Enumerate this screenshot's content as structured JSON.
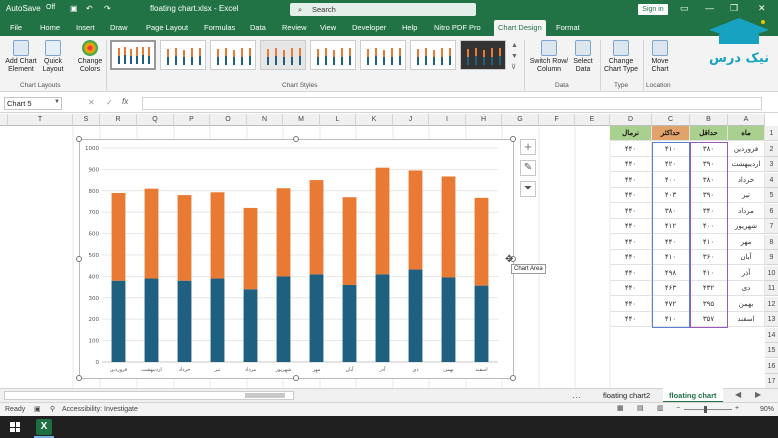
{
  "titlebar": {
    "autosave": "AutoSave",
    "autosave_state": "Off",
    "filename": "floating chart.xlsx - Excel",
    "search_placeholder": "Search",
    "signin": "Sign in"
  },
  "tabs": [
    "File",
    "Home",
    "Insert",
    "Draw",
    "Page Layout",
    "Formulas",
    "Data",
    "Review",
    "View",
    "Developer",
    "Help",
    "Nitro PDF Pro",
    "Chart Design",
    "Format"
  ],
  "active_tab": "Chart Design",
  "ribbon": {
    "add_chart_element": "Add Chart Element",
    "quick_layout": "Quick Layout",
    "change_colors": "Change Colors",
    "chart_layouts_group": "Chart Layouts",
    "chart_styles_group": "Chart Styles",
    "switch_row_col": "Switch Row/ Column",
    "select_data": "Select Data",
    "data_group": "Data",
    "change_chart_type": "Change Chart Type",
    "type_group": "Type",
    "move_chart": "Move Chart",
    "location_group": "Location"
  },
  "logo_text": "نیک درس",
  "namebox": "Chart 5",
  "columns": [
    "T",
    "S",
    "R",
    "Q",
    "P",
    "O",
    "N",
    "M",
    "L",
    "K",
    "J",
    "I",
    "H",
    "G",
    "F",
    "E",
    "D",
    "C",
    "B",
    "A"
  ],
  "table": {
    "headers": {
      "month": "ماه",
      "min": "حداقل",
      "max": "حداکثر",
      "normal": "نرمال"
    },
    "rows": [
      {
        "month": "فروردین",
        "min": "۳۸۰",
        "max": "۴۱۰",
        "normal": "۴۴۰"
      },
      {
        "month": "اردیبهشت",
        "min": "۳۹۰",
        "max": "۴۲۰",
        "normal": "۴۴۰"
      },
      {
        "month": "خرداد",
        "min": "۳۸۰",
        "max": "۴۰۰",
        "normal": "۴۴۰"
      },
      {
        "month": "تیر",
        "min": "۳۹۰",
        "max": "۴۰۳",
        "normal": "۴۴۰"
      },
      {
        "month": "مرداد",
        "min": "۳۴۰",
        "max": "۳۸۰",
        "normal": "۴۴۰"
      },
      {
        "month": "شهریور",
        "min": "۴۰۰",
        "max": "۴۱۲",
        "normal": "۴۴۰"
      },
      {
        "month": "مهر",
        "min": "۴۱۰",
        "max": "۴۴۰",
        "normal": "۴۴۰"
      },
      {
        "month": "آبان",
        "min": "۳۶۰",
        "max": "۴۱۰",
        "normal": "۴۴۰"
      },
      {
        "month": "آذر",
        "min": "۴۱۰",
        "max": "۴۹۸",
        "normal": "۴۴۰"
      },
      {
        "month": "دی",
        "min": "۴۳۲",
        "max": "۴۶۳",
        "normal": "۴۴۰"
      },
      {
        "month": "بهمن",
        "min": "۳۹۵",
        "max": "۴۷۲",
        "normal": "۴۴۰"
      },
      {
        "month": "اسفند",
        "min": "۳۵۷",
        "max": "۴۱۰",
        "normal": "۴۴۰"
      }
    ]
  },
  "chart_data": {
    "type": "bar",
    "stacked": true,
    "categories": [
      "فروردین",
      "اردیبهشت",
      "خرداد",
      "تیر",
      "مرداد",
      "شهریور",
      "مهر",
      "آبان",
      "آذر",
      "دی",
      "بهمن",
      "اسفند"
    ],
    "series": [
      {
        "values": [
          380,
          390,
          380,
          390,
          340,
          400,
          410,
          360,
          410,
          432,
          395,
          357
        ],
        "color": "#1f5f80"
      },
      {
        "values": [
          410,
          420,
          400,
          403,
          380,
          412,
          440,
          410,
          498,
          463,
          472,
          410
        ],
        "color": "#e87a33"
      }
    ],
    "ylim": [
      0,
      1000
    ],
    "yticks": [
      0,
      100,
      200,
      300,
      400,
      500,
      600,
      700,
      800,
      900,
      1000
    ],
    "grid": true
  },
  "tooltip": "Chart Area",
  "sheets": [
    "floating chart2",
    "floating chart"
  ],
  "active_sheet": "floating chart",
  "status": {
    "ready": "Ready",
    "accessibility": "Accessibility: Investigate",
    "zoom": "90%"
  }
}
